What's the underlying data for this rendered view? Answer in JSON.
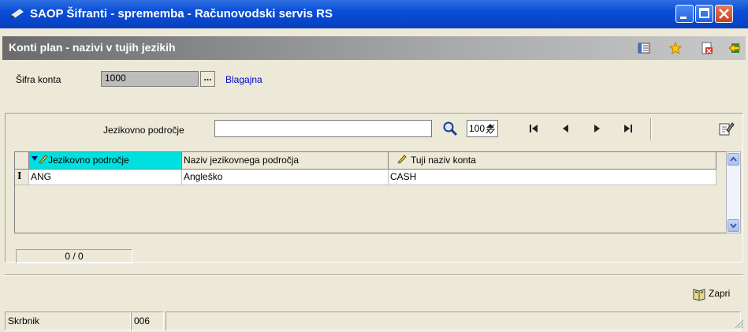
{
  "window": {
    "title": "SAOP  Šifranti - sprememba - Računovodski servis RS"
  },
  "form": {
    "title": "Konti plan - nazivi v tujih jezikih"
  },
  "sifra": {
    "label": "Šifra konta",
    "value": "1000",
    "lookup_label": "...",
    "name": "Blagajna"
  },
  "filter": {
    "label": "Jezikovno področje",
    "value": "",
    "count": "100"
  },
  "grid": {
    "columns": [
      "Jezikovno področje",
      "Naziv jezikovnega področja",
      "Tuji naziv konta"
    ],
    "rows": [
      {
        "indicator": "I",
        "code": "ANG",
        "name": "Angleško",
        "foreign_name": "CASH"
      }
    ]
  },
  "records": {
    "text": "0 / 0"
  },
  "buttons": {
    "close_label": "Zapri"
  },
  "status": {
    "user": "Skrbnik",
    "code": "006",
    "message": ""
  },
  "icons": [
    "pen-icon",
    "columns-icon",
    "star-icon",
    "delete-icon",
    "exit-icon",
    "search-icon",
    "spin-icon",
    "first-icon",
    "prev-icon",
    "next-icon",
    "last-icon",
    "edit-icon",
    "book-icon"
  ],
  "colors": {
    "title_bar": "#0a4ed8",
    "subtitle_bar": "#8a8a8a",
    "active_header": "#00e0e0",
    "link": "#0000cc"
  }
}
